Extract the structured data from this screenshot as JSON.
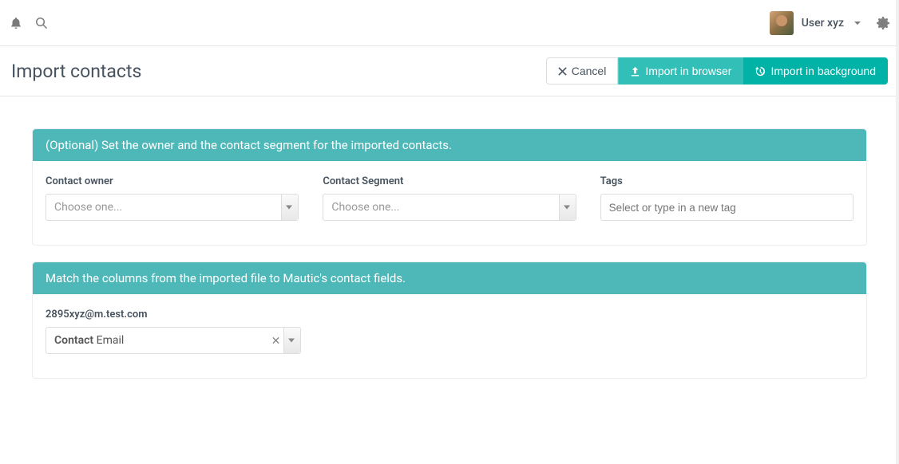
{
  "header": {
    "user_name": "User xyz"
  },
  "page": {
    "title": "Import contacts"
  },
  "buttons": {
    "cancel": "Cancel",
    "import_browser": "Import in browser",
    "import_background": "Import in background"
  },
  "panel1": {
    "heading": "(Optional) Set the owner and the contact segment for the imported contacts.",
    "owner_label": "Contact owner",
    "owner_placeholder": "Choose one...",
    "segment_label": "Contact Segment",
    "segment_placeholder": "Choose one...",
    "tags_label": "Tags",
    "tags_placeholder": "Select or type in a new tag"
  },
  "panel2": {
    "heading": "Match the columns from the imported file to Mautic's contact fields.",
    "column_name": "2895xyz@m.test.com",
    "field_group": "Contact",
    "field_name": "Email"
  }
}
